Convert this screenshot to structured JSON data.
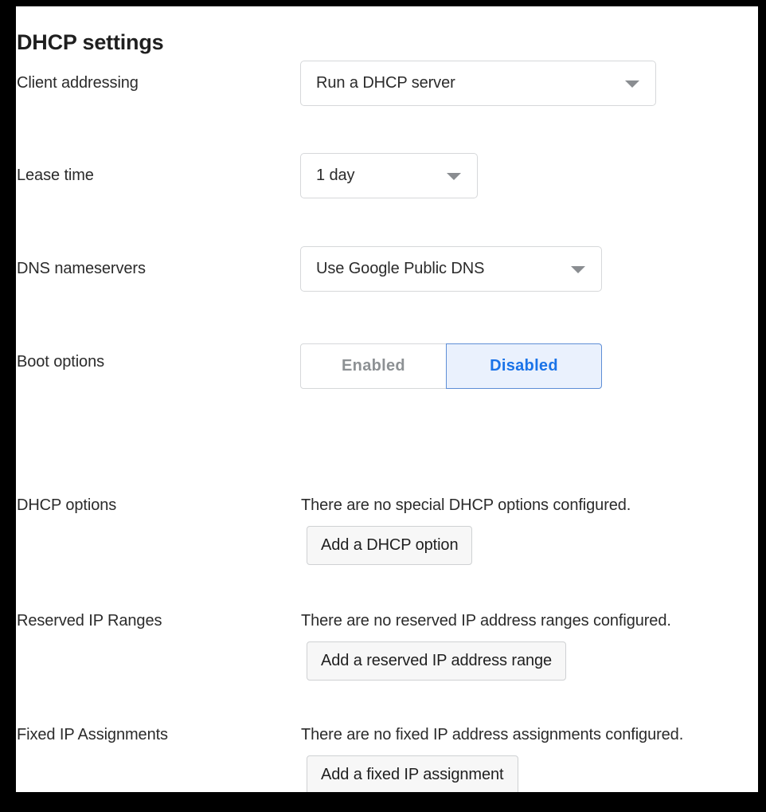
{
  "page": {
    "title": "DHCP settings"
  },
  "rows": [
    {
      "key": "client_addressing",
      "label": "Client addressing",
      "control": "select",
      "value": "Run a DHCP server"
    },
    {
      "key": "lease_time",
      "label": "Lease time",
      "control": "select",
      "value": "1 day"
    },
    {
      "key": "dns_nameservers",
      "label": "DNS nameservers",
      "control": "select",
      "value": "Use Google Public DNS"
    },
    {
      "key": "boot_options",
      "label": "Boot options",
      "control": "segmented",
      "options": [
        "Enabled",
        "Disabled"
      ],
      "selected": "Disabled"
    },
    {
      "key": "dhcp_options",
      "label": "DHCP options",
      "control": "empty_state",
      "empty_text": "There are no special DHCP options configured.",
      "button_label": "Add a DHCP option"
    },
    {
      "key": "reserved_ip_ranges",
      "label": "Reserved IP Ranges",
      "control": "empty_state",
      "empty_text": "There are no reserved IP address ranges configured.",
      "button_label": "Add a reserved IP address range"
    },
    {
      "key": "fixed_ip_assignments",
      "label": "Fixed IP Assignments",
      "control": "empty_state",
      "empty_text": "There are no fixed IP address assignments configured.",
      "button_label": "Add a fixed IP assignment"
    }
  ],
  "icons": {
    "caret": "chevron-down-icon"
  },
  "colors": {
    "accent_blue": "#1a73e8",
    "selected_bg": "#eaf1fd",
    "selected_border": "#5e8ed6",
    "text": "#2b2b2b",
    "muted_text": "#8d9194",
    "border": "#d6d8da",
    "button_bg": "#f7f7f7",
    "frame": "#000000",
    "panel_bg": "#ffffff"
  }
}
